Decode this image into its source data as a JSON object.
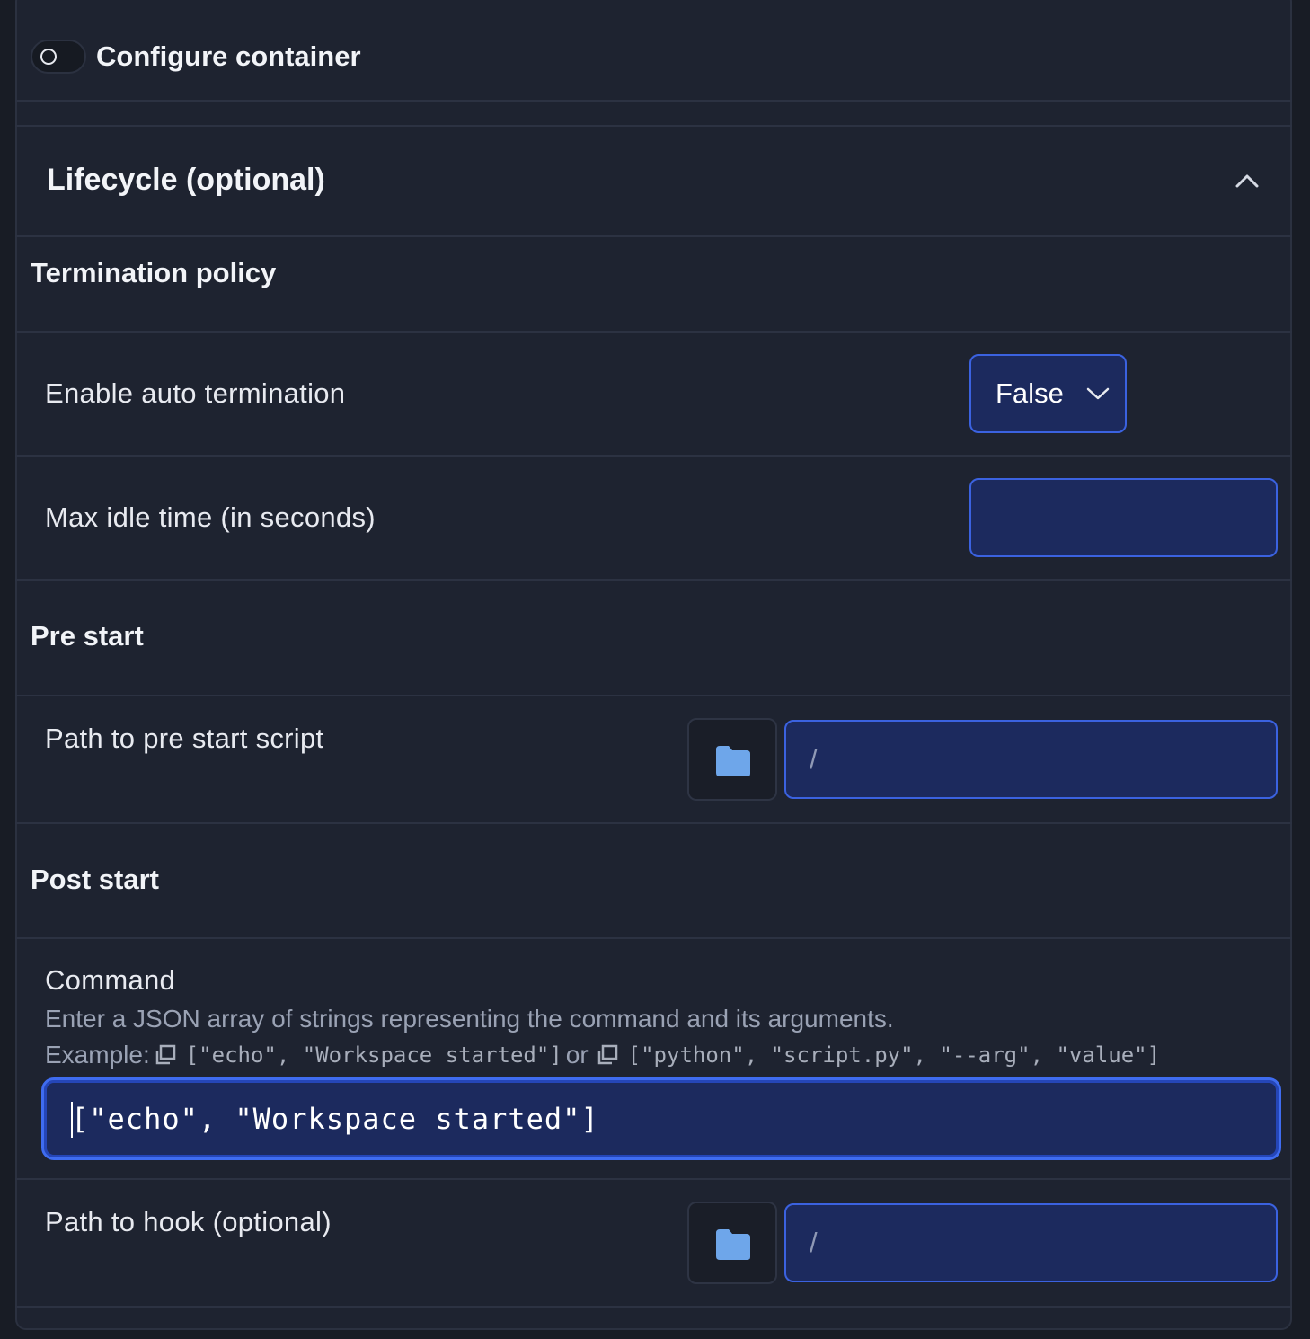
{
  "container": {
    "toggle_label": "Configure container"
  },
  "lifecycle": {
    "title": "Lifecycle (optional)"
  },
  "termination": {
    "heading": "Termination policy",
    "auto_label": "Enable auto termination",
    "auto_value": "False",
    "idle_label": "Max idle time (in seconds)",
    "idle_value": ""
  },
  "pre_start": {
    "heading": "Pre start",
    "path_label": "Path to pre start script",
    "path_placeholder": "/"
  },
  "post_start": {
    "heading": "Post start",
    "command_label": "Command",
    "command_desc": "Enter a JSON array of strings representing the command and its arguments.",
    "example_prefix": "Example:",
    "example_1": "[\"echo\", \"Workspace started\"]",
    "example_or": "or",
    "example_2": "[\"python\", \"script.py\", \"--arg\", \"value\"]",
    "command_value": "[\"echo\", \"Workspace started\"]",
    "hook_label": "Path to hook (optional)",
    "hook_placeholder": "/"
  },
  "colors": {
    "accent": "#3b62e0",
    "input_bg": "#1c2a5e",
    "panel_bg": "#1e2330",
    "folder": "#6ea6ea"
  }
}
